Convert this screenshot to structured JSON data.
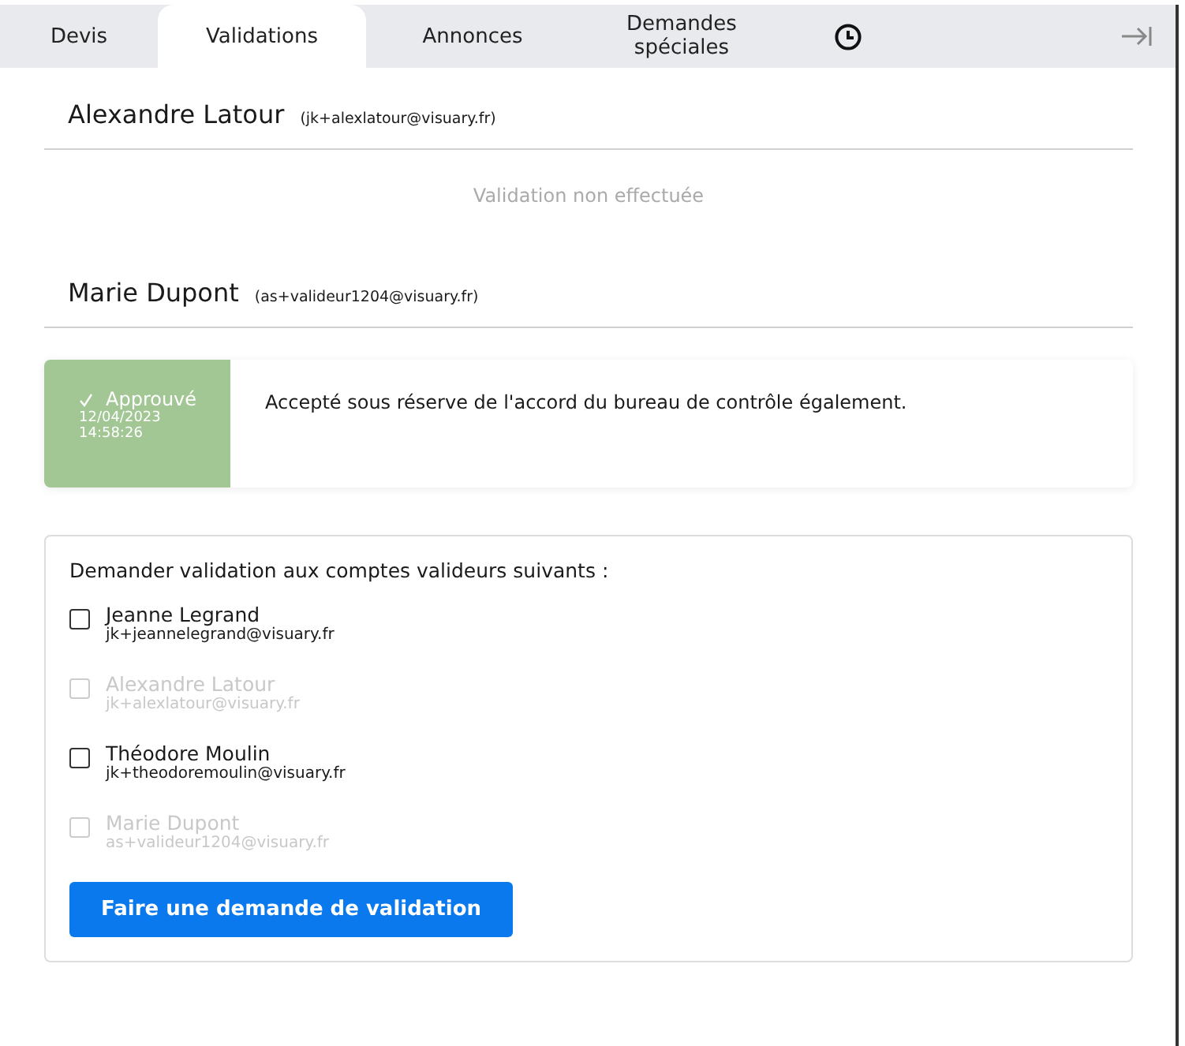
{
  "tabs": [
    {
      "label": "Devis",
      "selected": false
    },
    {
      "label": "Validations",
      "selected": true
    },
    {
      "label": "Annonces",
      "selected": false
    },
    {
      "label": "Demandes spéciales",
      "selected": false
    }
  ],
  "validators": [
    {
      "name": "Alexandre Latour",
      "email": "(jk+alexlatour@visuary.fr)",
      "result": {
        "kind": "pending",
        "text": "Validation non effectuée"
      }
    },
    {
      "name": "Marie Dupont",
      "email": "(as+valideur1204@visuary.fr)",
      "result": {
        "kind": "approved",
        "status": "Approuvé",
        "date": "12/04/2023",
        "time": "14:58:26",
        "comment": "Accepté sous réserve de l'accord du bureau de contrôle également."
      }
    }
  ],
  "request": {
    "prompt": "Demander validation aux comptes valideurs suivants :",
    "accounts": [
      {
        "name": "Jeanne Legrand",
        "email": "jk+jeannelegrand@visuary.fr",
        "checked": false,
        "disabled": false
      },
      {
        "name": "Alexandre Latour",
        "email": "jk+alexlatour@visuary.fr",
        "checked": false,
        "disabled": true
      },
      {
        "name": "Théodore Moulin",
        "email": "jk+theodoremoulin@visuary.fr",
        "checked": false,
        "disabled": false
      },
      {
        "name": "Marie Dupont",
        "email": "as+valideur1204@visuary.fr",
        "checked": false,
        "disabled": true
      }
    ],
    "button": "Faire une demande de validation"
  }
}
